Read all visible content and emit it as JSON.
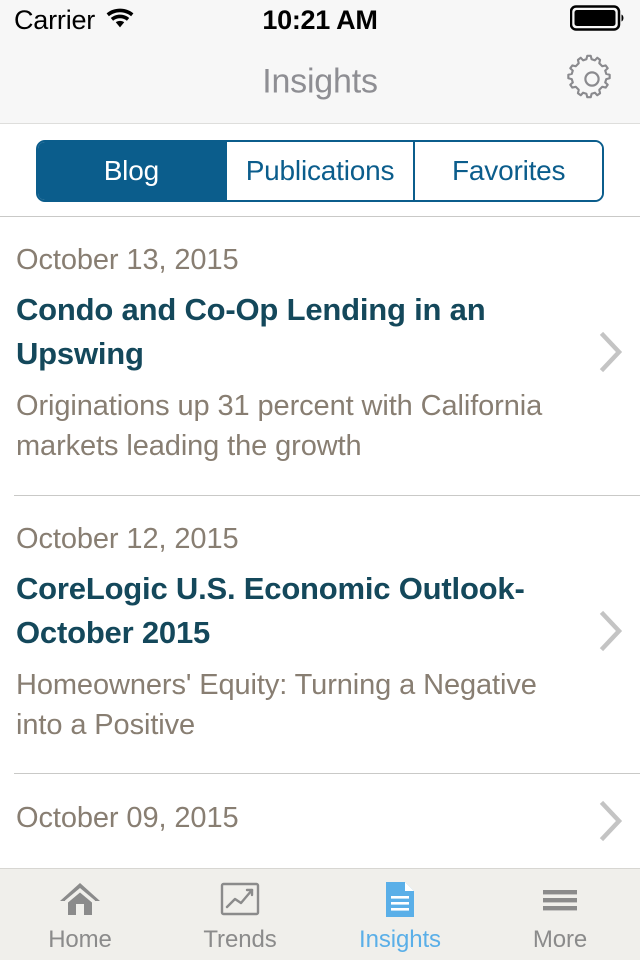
{
  "status_bar": {
    "carrier": "Carrier",
    "wifi_icon": "wifi-icon",
    "time": "10:21 AM",
    "battery_icon": "battery-full-icon"
  },
  "nav_bar": {
    "title": "Insights",
    "settings_icon": "gear-icon"
  },
  "segmented_control": {
    "segments": [
      {
        "label": "Blog",
        "selected": true
      },
      {
        "label": "Publications",
        "selected": false
      },
      {
        "label": "Favorites",
        "selected": false
      }
    ]
  },
  "list": {
    "items": [
      {
        "date": "October 13, 2015",
        "title": "Condo and Co-Op Lending in an Upswing",
        "subtitle": "Originations up 31 percent with California markets leading the growth",
        "chevron_icon": "chevron-right-icon"
      },
      {
        "date": "October 12, 2015",
        "title": "CoreLogic U.S. Economic Outlook- October 2015",
        "subtitle": "Homeowners' Equity: Turning a Negative into a Positive",
        "chevron_icon": "chevron-right-icon"
      },
      {
        "date": "October 09, 2015",
        "title": "",
        "subtitle": "",
        "chevron_icon": "chevron-right-icon"
      }
    ]
  },
  "tab_bar": {
    "tabs": [
      {
        "label": "Home",
        "icon": "home-icon",
        "active": false
      },
      {
        "label": "Trends",
        "icon": "chart-line-icon",
        "active": false
      },
      {
        "label": "Insights",
        "icon": "document-icon",
        "active": true
      },
      {
        "label": "More",
        "icon": "hamburger-icon",
        "active": false
      }
    ]
  },
  "colors": {
    "accent_blue": "#0b5d8c",
    "active_tab_blue": "#5aafe8",
    "title_teal": "#14485b",
    "muted_brown": "#887e72",
    "nav_background": "#f7f7f7",
    "tab_background": "#f0efeb"
  }
}
